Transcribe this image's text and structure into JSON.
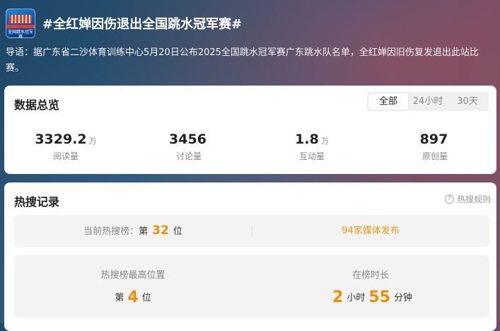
{
  "topic": {
    "title": "#全红婵因伤退出全国跳水冠军赛#",
    "logo_text": "全国跳水冠军赛",
    "intro": "导语：据广东省二沙体育训练中心5月20日公布2025全国跳水冠军赛广东跳水队名单，全红婵因旧伤复发退出此站比赛。"
  },
  "overview": {
    "title": "数据总览",
    "tabs": [
      {
        "label": "全部",
        "active": true
      },
      {
        "label": "24小时",
        "active": false
      },
      {
        "label": "30天",
        "active": false
      }
    ],
    "stats": [
      {
        "value": "3329.2",
        "unit": "万",
        "label": "阅读量"
      },
      {
        "value": "3456",
        "unit": "",
        "label": "讨论量"
      },
      {
        "value": "1.8",
        "unit": "万",
        "label": "互动量"
      },
      {
        "value": "897",
        "unit": "",
        "label": "原创量"
      }
    ]
  },
  "hot": {
    "title": "热搜记录",
    "rule_label": "热搜规则",
    "current_label": "当前热搜榜：",
    "current_prefix": "第",
    "current_rank": "32",
    "current_suffix": "位",
    "media_link": "94家媒体发布",
    "best_label": "热搜榜最高位置",
    "best_prefix": "第",
    "best_rank": "4",
    "best_suffix": "位",
    "duration_label": "在榜时长",
    "duration_hours": "2",
    "hours_unit": "小时",
    "duration_minutes": "55",
    "minutes_unit": "分钟"
  },
  "colors": {
    "accent": "#f08c00",
    "link": "#e59a12"
  }
}
